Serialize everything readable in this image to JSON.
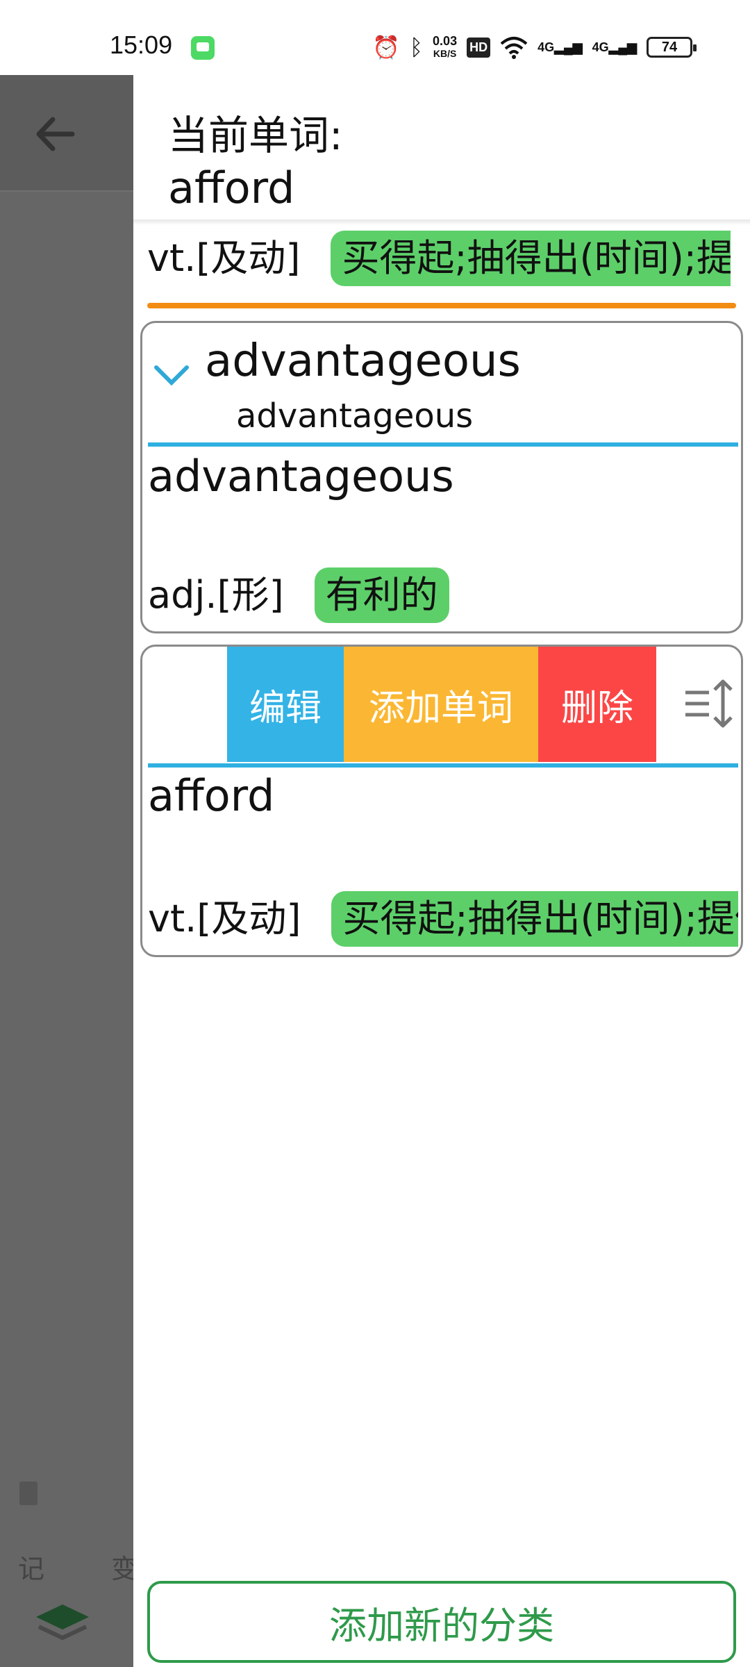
{
  "status_bar": {
    "time": "15:09",
    "net_speed_value": "0.03",
    "net_speed_unit": "KB/S",
    "hd_label": "HD",
    "net_label_1": "4G",
    "net_label_2": "4G",
    "battery": "74",
    "icons": [
      "message-icon",
      "alarm-icon",
      "bluetooth-icon",
      "hd-icon",
      "wifi-icon",
      "signal-icon",
      "signal-icon",
      "battery-icon"
    ]
  },
  "background_app": {
    "tab_labels": [
      "记",
      "变"
    ],
    "icons": [
      "back-arrow-icon",
      "document-icon",
      "layers-icon"
    ]
  },
  "current_word": {
    "label": "当前单词:",
    "word": "afford",
    "pos": "vt.[及动]",
    "meaning": "买得起;抽得出(时间);提供"
  },
  "categories": [
    {
      "title": "advantageous",
      "subtitle": "advantageous",
      "expanded": true,
      "words": [
        {
          "word": "advantageous",
          "pos": "adj.[形]",
          "meaning": "有利的"
        }
      ]
    },
    {
      "actions": {
        "edit": "编辑",
        "add_word": "添加单词",
        "delete": "删除"
      },
      "words": [
        {
          "word": "afford",
          "pos": "vt.[及动]",
          "meaning": "买得起;抽得出(时间);提供"
        }
      ]
    }
  ],
  "add_category_button": "添加新的分类",
  "colors": {
    "tag_green": "#5dcf69",
    "orange_divider": "#f28c13",
    "blue_divider": "#2fb0e0",
    "edit_blue": "#33b3e6",
    "add_yellow": "#fbb733",
    "delete_red": "#fc4646",
    "button_green": "#2e9a4a"
  }
}
